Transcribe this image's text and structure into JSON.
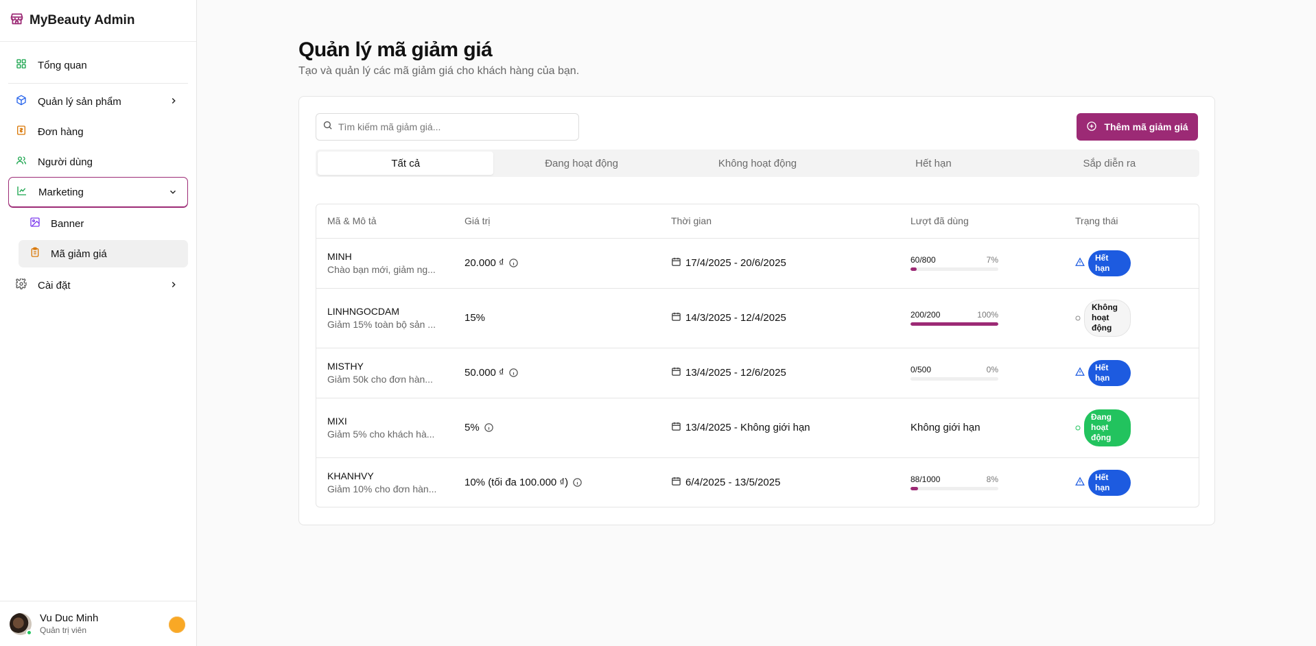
{
  "app": {
    "title": "MyBeauty Admin"
  },
  "sidebar": {
    "items": [
      {
        "label": "Tổng quan",
        "icon": "dashboard-icon"
      },
      {
        "label": "Quản lý sản phẩm",
        "icon": "box-icon"
      },
      {
        "label": "Đơn hàng",
        "icon": "receipt-icon"
      },
      {
        "label": "Người dùng",
        "icon": "users-icon"
      },
      {
        "label": "Marketing",
        "icon": "chart-line-icon"
      },
      {
        "label": "Cài đặt",
        "icon": "gear-icon"
      }
    ],
    "marketing_sub": [
      {
        "label": "Banner",
        "icon": "image-icon"
      },
      {
        "label": "Mã giảm giá",
        "icon": "clipboard-icon"
      }
    ]
  },
  "user": {
    "name": "Vu Duc Minh",
    "role": "Quản trị viên"
  },
  "page": {
    "title": "Quản lý mã giảm giá",
    "subtitle": "Tạo và quản lý các mã giảm giá cho khách hàng của bạn."
  },
  "search": {
    "placeholder": "Tìm kiếm mã giảm giá..."
  },
  "add_button": {
    "label": "Thêm mã giảm giá"
  },
  "tabs": [
    "Tất cả",
    "Đang hoạt động",
    "Không hoạt động",
    "Hết hạn",
    "Sắp diễn ra"
  ],
  "table": {
    "headers": [
      "Mã & Mô tả",
      "Giá trị",
      "Thời gian",
      "Lượt đã dùng",
      "Trạng thái"
    ],
    "rows": [
      {
        "code": "MINH",
        "desc": "Chào bạn mới, giảm ng...",
        "value": "20.000 ₫",
        "dates": "17/4/2025 - 20/6/2025",
        "usage": "60/800",
        "pct": "7%",
        "fill": 7,
        "status_line1": "Hết",
        "status_line2": "hạn",
        "status_line3": ""
      },
      {
        "code": "LINHNGOCDAM",
        "desc": "Giảm 15% toàn bộ sản ...",
        "value": "15%",
        "dates": "14/3/2025 - 12/4/2025",
        "usage": "200/200",
        "pct": "100%",
        "fill": 100,
        "status_line1": "Không",
        "status_line2": "hoạt",
        "status_line3": "động"
      },
      {
        "code": "MISTHY",
        "desc": "Giảm 50k cho đơn hàn...",
        "value": "50.000 ₫",
        "dates": "13/4/2025 - 12/6/2025",
        "usage": "0/500",
        "pct": "0%",
        "fill": 0,
        "status_line1": "Hết",
        "status_line2": "hạn",
        "status_line3": ""
      },
      {
        "code": "MIXI",
        "desc": "Giảm 5% cho khách hà...",
        "value": "5%",
        "dates": "13/4/2025 - Không giới hạn",
        "usage_text": "Không giới hạn",
        "status_line1": "Đang",
        "status_line2": "hoạt",
        "status_line3": "động"
      },
      {
        "code": "KHANHVY",
        "desc": "Giảm 10% cho đơn hàn...",
        "value": "10% (tối đa 100.000 ₫)",
        "dates": "6/4/2025 - 13/5/2025",
        "usage": "88/1000",
        "pct": "8%",
        "fill": 8.8,
        "status_line1": "Hết",
        "status_line2": "hạn",
        "status_line3": ""
      }
    ]
  },
  "colors": {
    "accent": "#9c2a75",
    "expired": "#1d5be0",
    "active": "#22c35e"
  }
}
